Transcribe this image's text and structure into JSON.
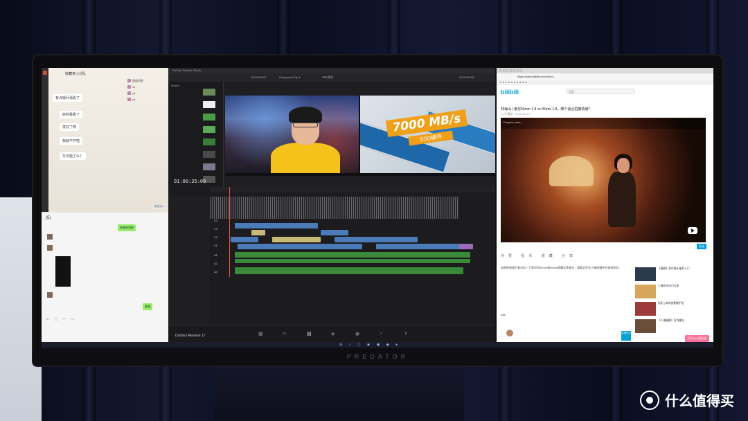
{
  "wechat": {
    "window_title": "收藏夹小分队",
    "group_label": "群组消息",
    "send_label": "发送(S)",
    "chat_header": "(5)",
    "tag": "发来的消息",
    "reply": "视频",
    "bubbles": [
      "有点疑问请看了",
      "好的我看了",
      "发好了啊",
      "我就不开啦",
      "又可能了么？"
    ],
    "list_items": [
      "mi",
      "yd",
      "ps"
    ]
  },
  "resolve": {
    "app_title": "DaVinci Resolve Studio",
    "project_title": "SSD测评",
    "compound_clip": "Compound Clip 1",
    "timecode_left": "00:00:04:07",
    "timecode_right": "01:00:35:09",
    "timecode_main": "01:00:35:09",
    "media_label": "Master",
    "clip_title": "7000 MB/s",
    "clip_subtitle": "SSD横评",
    "track_labels": [
      "V4",
      "V3",
      "V2",
      "V1",
      "A1",
      "A2",
      "A3"
    ],
    "logo_text": "DaVinci Resolve 17",
    "pages": [
      "媒体",
      "快编",
      "剪辑",
      "Fusion",
      "调色",
      "Fairlight",
      "交付"
    ]
  },
  "browser": {
    "url": "https://www.bilibili.com/video/...",
    "logo": "bilibili",
    "search_placeholder": "搜索",
    "video_title": "林海山 | 索尼55mm 1.8 vs 85mm 1.8，哪个适合拍摄情绪?",
    "meta": "1.2万播放 · 2022-02-10",
    "player_overlay": "Drag for menu",
    "send_danmaku": "发送",
    "actions": "点赞 投币 收藏 分享",
    "desc": "这期视频我们来对比一下索尼的55mm和85mm两颗定焦镜头，看看它们在人像拍摄中的表现差异...",
    "recommendations": [
      {
        "text": "【摄影】索尼镜头推荐入门",
        "color": "#2b3a4c"
      },
      {
        "text": "人像布光技巧分享",
        "color": "#d8a65a"
      },
      {
        "text": "街拍 | 城市夜景随手拍",
        "color": "#9c3a3a"
      },
      {
        "text": "【人像摄影】室内暖光",
        "color": "#6a4e3a"
      }
    ],
    "comment_tab": "486",
    "comment_btn": "发表评论",
    "pink_btn": "打开App看高清"
  },
  "watermark": {
    "text": "什么值得买"
  },
  "colors": {
    "bili_blue": "#00a1d6",
    "bili_pink": "#fb7299",
    "wechat_green": "#95ec69",
    "resolve_bg": "#1f1f22",
    "ssd_orange": "#f0a018"
  }
}
